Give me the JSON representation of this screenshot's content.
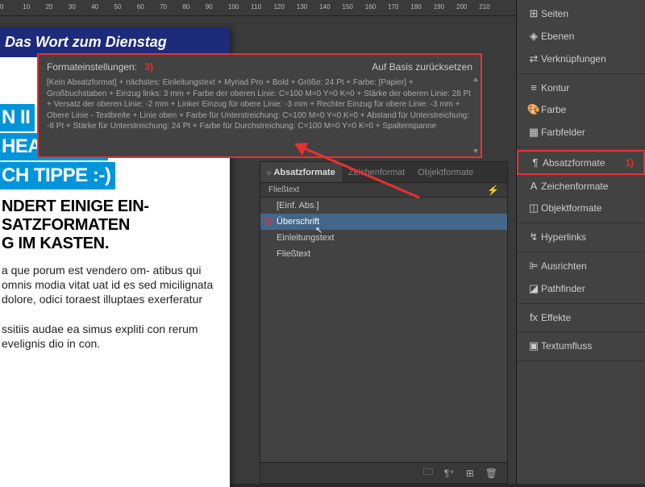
{
  "ruler": {
    "marks": [
      0,
      10,
      20,
      30,
      40,
      50,
      60,
      70,
      80,
      90,
      100,
      110,
      120,
      130,
      140,
      150,
      160,
      170,
      180,
      190,
      200,
      210
    ]
  },
  "page": {
    "header": "Das Wort zum Dienstag",
    "headline_lines": [
      "N II",
      "HEADLINE-",
      "CH TIPPE :-)"
    ],
    "subheading": [
      "NDERT EINIGE EIN-",
      "SATZFORMATEN",
      "G IM KASTEN."
    ],
    "body1": "a que porum est vendero om- atibus qui omnis modia vitat uat id es sed micilignata dolore, odici toraest illuptaes exerferatur",
    "body2": "ssitiis audae ea simus expliti con rerum evelignis dio in con."
  },
  "tooltip": {
    "title": "Formateinstellungen:",
    "annot": "3)",
    "reset": "Auf Basis zurücksetzen",
    "body": "[Kein Absatzformat] + nächstes: Einleitungstext + Myriad Pro + Bold + Größe: 24 Pt + Farbe: [Papier] + Großbuchstaben + Einzug links: 3 mm + Farbe der oberen Linie: C=100 M=0 Y=0 K=0 + Stärke der oberen Linie: 28 Pt + Versatz der oberen Linie: -2 mm + Linker Einzug für obere Linie: -3 mm + Rechter Einzug für obere Linie: -3 mm + Obere Linie - Textbreite + Linie oben + Farbe für Unterstreichung: C=100 M=0 Y=0 K=0 + Abstand für Unterstreichung: -8 Pt + Stärke für Unterstreichung: 24 Pt + Farbe für Durchstreichung: C=100 M=0 Y=0 K=0 + Spaltenspanne"
  },
  "para_panel": {
    "tabs": {
      "active": "Absatzformate",
      "t2": "Zeichenformat",
      "t3": "Objektformate"
    },
    "subtitle": "Fließtext",
    "items": [
      {
        "label": "[Einf. Abs.]",
        "selected": false
      },
      {
        "label": "Überschrift",
        "selected": true,
        "annot": "2)"
      },
      {
        "label": "Einleitungstext",
        "selected": false
      },
      {
        "label": "Fließtext",
        "selected": false
      }
    ]
  },
  "side": {
    "groups": [
      [
        {
          "icon": "⊞",
          "label": "Seiten"
        },
        {
          "icon": "◈",
          "label": "Ebenen"
        },
        {
          "icon": "⇄",
          "label": "Verknüpfungen"
        }
      ],
      [
        {
          "icon": "≡",
          "label": "Kontur"
        },
        {
          "icon": "🎨",
          "label": "Farbe"
        },
        {
          "icon": "▦",
          "label": "Farbfelder"
        }
      ],
      [
        {
          "icon": "¶",
          "label": "Absatzformate",
          "highlight": true,
          "annot": "1)"
        },
        {
          "icon": "A",
          "label": "Zeichenformate"
        },
        {
          "icon": "◫",
          "label": "Objektformate"
        }
      ],
      [
        {
          "icon": "↯",
          "label": "Hyperlinks"
        }
      ],
      [
        {
          "icon": "⊫",
          "label": "Ausrichten"
        },
        {
          "icon": "◪",
          "label": "Pathfinder"
        }
      ],
      [
        {
          "icon": "fx",
          "label": "Effekte"
        }
      ],
      [
        {
          "icon": "▣",
          "label": "Textumfluss"
        }
      ]
    ]
  }
}
